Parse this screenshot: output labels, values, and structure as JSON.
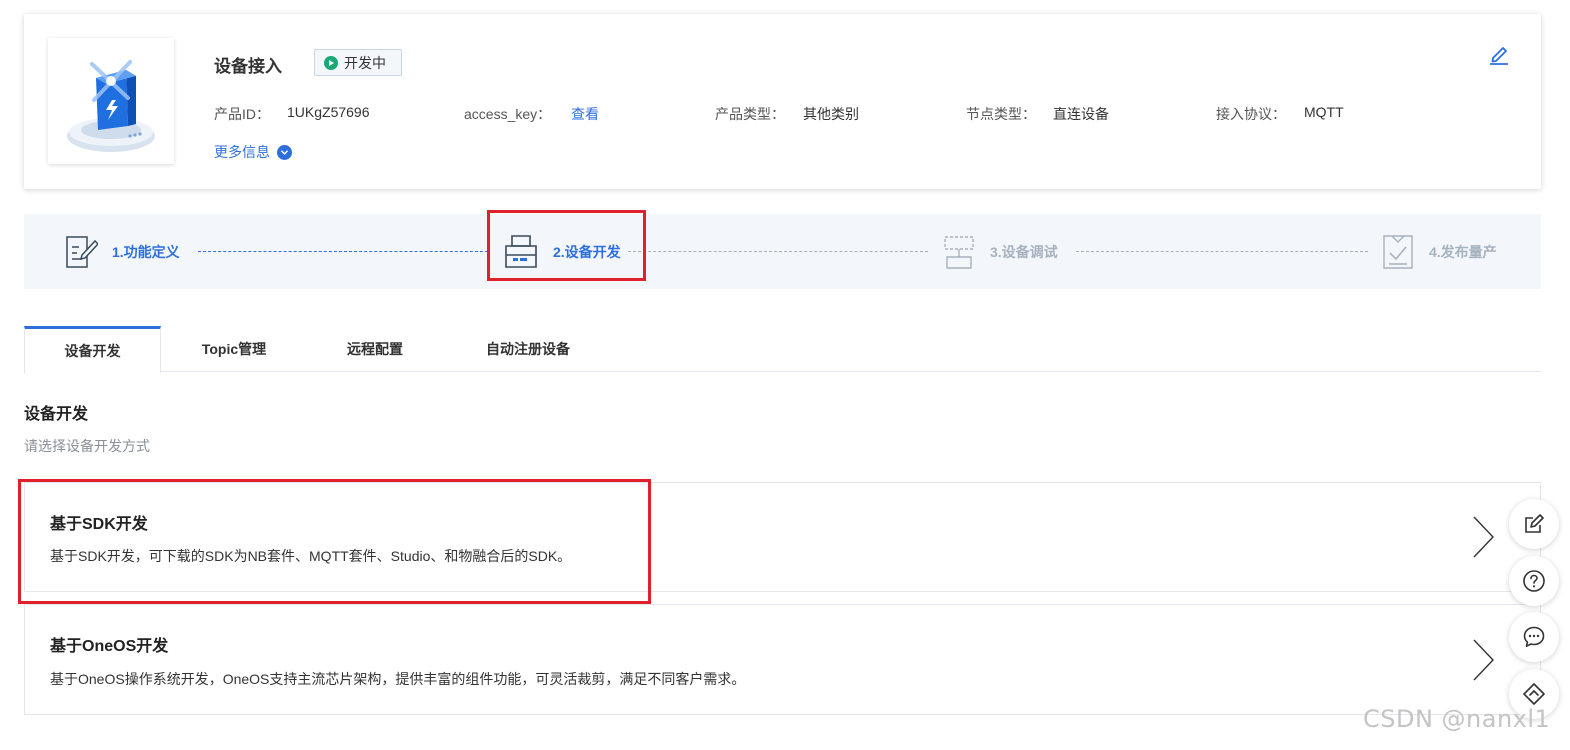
{
  "product": {
    "name": "设备接入",
    "status": "开发中",
    "fields": {
      "product_id_label": "产品ID：",
      "product_id_value": "1UKgZ57696",
      "access_key_label": "access_key：",
      "access_key_link": "查看",
      "product_type_label": "产品类型：",
      "product_type_value": "其他类别",
      "node_type_label": "节点类型：",
      "node_type_value": "直连设备",
      "protocol_label": "接入协议：",
      "protocol_value": "MQTT"
    },
    "more_info": "更多信息"
  },
  "steps": [
    {
      "label": "1.功能定义",
      "state": "done",
      "icon": "document-edit-icon"
    },
    {
      "label": "2.设备开发",
      "state": "active",
      "icon": "printer-device-icon"
    },
    {
      "label": "3.设备调试",
      "state": "pending",
      "icon": "debug-device-icon"
    },
    {
      "label": "4.发布量产",
      "state": "pending",
      "icon": "release-check-icon"
    }
  ],
  "tabs": [
    {
      "label": "设备开发",
      "active": true
    },
    {
      "label": "Topic管理",
      "active": false
    },
    {
      "label": "远程配置",
      "active": false
    },
    {
      "label": "自动注册设备",
      "active": false
    }
  ],
  "section": {
    "title": "设备开发",
    "subtitle": "请选择设备开发方式"
  },
  "options": [
    {
      "title": "基于SDK开发",
      "description": "基于SDK开发，可下载的SDK为NB套件、MQTT套件、Studio、和物融合后的SDK。"
    },
    {
      "title": "基于OneOS开发",
      "description": "基于OneOS操作系统开发，OneOS支持主流芯片架构，提供丰富的组件功能，可灵活裁剪，满足不同客户需求。"
    }
  ],
  "floating_buttons": [
    "feedback-edit-icon",
    "help-icon",
    "chat-icon",
    "back-to-top-icon"
  ],
  "watermark": "CSDN @nanxl1",
  "colors": {
    "accent": "#2f6fdd",
    "status_green": "#19a974",
    "highlight_red": "#e0202a",
    "muted": "#a7b2bf"
  }
}
